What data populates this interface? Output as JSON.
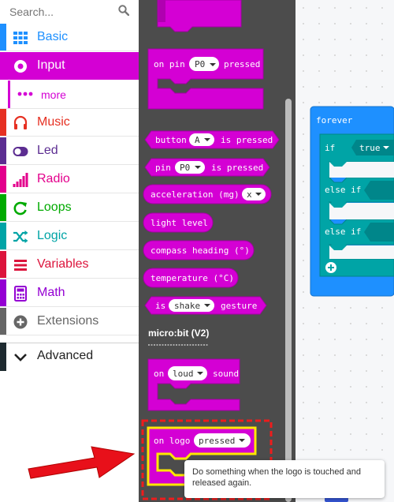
{
  "search": {
    "placeholder": "Search..."
  },
  "categories": [
    {
      "label": "Basic",
      "color": "#1e90ff",
      "icon": "grid-icon"
    },
    {
      "label": "Input",
      "color": "#d400d4",
      "icon": "circle-dot-icon",
      "selected": true
    },
    {
      "label": "more",
      "color": "#d400d4",
      "icon": "ellipsis-icon",
      "sub": true
    },
    {
      "label": "Music",
      "color": "#e63022",
      "icon": "headphones-icon"
    },
    {
      "label": "Led",
      "color": "#5c2d91",
      "icon": "toggle-icon"
    },
    {
      "label": "Radio",
      "color": "#e3008c",
      "icon": "signal-bars-icon"
    },
    {
      "label": "Loops",
      "color": "#00aa00",
      "icon": "refresh-icon"
    },
    {
      "label": "Logic",
      "color": "#00a4a6",
      "icon": "shuffle-icon"
    },
    {
      "label": "Variables",
      "color": "#dc143c",
      "icon": "list-icon"
    },
    {
      "label": "Math",
      "color": "#9400d3",
      "icon": "calculator-icon"
    },
    {
      "label": "Extensions",
      "color": "#666666",
      "icon": "plus-circle-icon"
    },
    {
      "label": "Advanced",
      "color": "#222222",
      "icon": "chevron-down-icon"
    }
  ],
  "flyout": {
    "on_pin": {
      "prefix": "on pin",
      "pin": "P0",
      "suffix": "pressed"
    },
    "button_pressed": {
      "prefix": "button",
      "value": "A",
      "suffix": "is pressed"
    },
    "pin_pressed": {
      "prefix": "pin",
      "value": "P0",
      "suffix": "is pressed"
    },
    "acceleration": {
      "prefix": "acceleration (mg)",
      "value": "x"
    },
    "light_level": "light level",
    "compass_heading": "compass heading (°)",
    "temperature": "temperature (°C)",
    "gesture": {
      "prefix": "is",
      "value": "shake",
      "suffix": "gesture"
    },
    "section_label": "micro:bit (V2)",
    "on_loud": {
      "prefix": "on",
      "value": "loud",
      "suffix": "sound"
    },
    "on_logo": {
      "prefix": "on logo",
      "value": "pressed"
    }
  },
  "workspace": {
    "forever_label": "forever",
    "if_label": "if",
    "true_value": "true",
    "else_if_1": "else if",
    "else_if_2": "else if"
  },
  "tooltip": {
    "text": "Do something when the logo is touched and released again."
  },
  "colors": {
    "input": "#d400d4",
    "logic_block": "#1e90ff",
    "highlight": "#ffe800",
    "annotation_red": "#ee1c1c",
    "flyout_bg": "#4c4c4c"
  }
}
